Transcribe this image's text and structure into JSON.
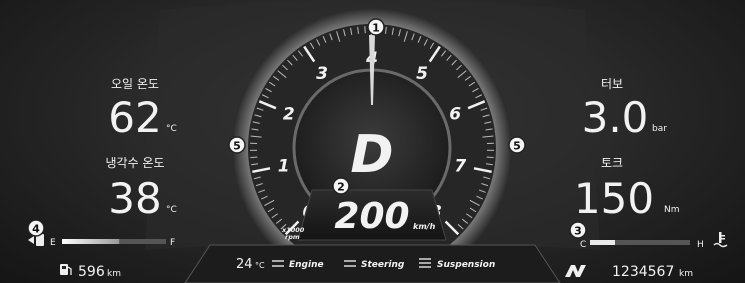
{
  "left": {
    "oil_label": "오일 온도",
    "oil_value": "62",
    "oil_unit": "°C",
    "coolant_label": "냉각수 온도",
    "coolant_value": "38",
    "coolant_unit": "°C",
    "fuel_empty": "E",
    "fuel_full": "F",
    "range_value": "596",
    "range_unit": "km"
  },
  "right": {
    "turbo_label": "터보",
    "turbo_value": "3.0",
    "turbo_unit": "bar",
    "torque_label": "토크",
    "torque_value": "150",
    "torque_unit": "Nm",
    "temp_cold": "C",
    "temp_hot": "H",
    "odo_value": "1234567",
    "odo_unit": "km"
  },
  "center": {
    "gear": "D",
    "speed": "200",
    "speed_unit": "km/h",
    "rpm_unit_1": "x1000",
    "rpm_unit_2": "rpm",
    "tach_labels": [
      "0",
      "1",
      "2",
      "3",
      "4",
      "5",
      "6",
      "7",
      "8"
    ]
  },
  "bottom": {
    "ambient_value": "24",
    "ambient_unit": "°C",
    "mode_engine": "Engine",
    "mode_steering": "Steering",
    "mode_suspension": "Suspension"
  },
  "callouts": [
    "1",
    "2",
    "3",
    "4",
    "5",
    "5"
  ],
  "gauges": {
    "fuel_level": 0.55,
    "coolant_temp_level": 0.25,
    "rpm_needle": 4
  }
}
